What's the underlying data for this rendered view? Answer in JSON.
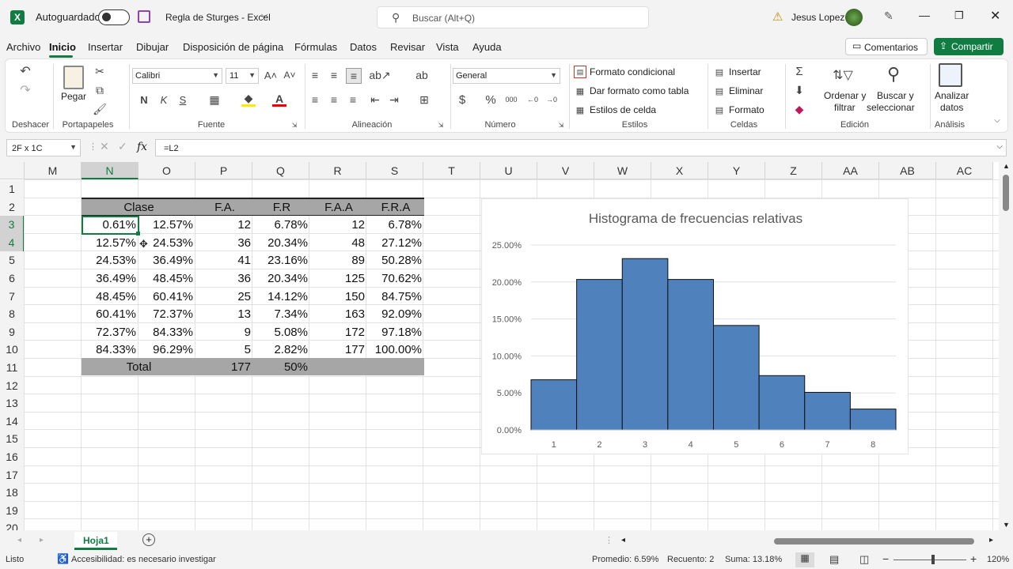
{
  "titlebar": {
    "autosave_label": "Autoguardado",
    "filename": "Regla de Sturges - Excel",
    "search_placeholder": "Buscar (Alt+Q)",
    "user_name": "Jesus Lopez"
  },
  "menu": {
    "tabs": [
      "Archivo",
      "Inicio",
      "Insertar",
      "Dibujar",
      "Disposición de página",
      "Fórmulas",
      "Datos",
      "Revisar",
      "Vista",
      "Ayuda"
    ],
    "comments_label": "Comentarios",
    "share_label": "Compartir"
  },
  "ribbon": {
    "groups": {
      "undo": "Deshacer",
      "clipboard": "Portapapeles",
      "font": "Fuente",
      "alignment": "Alineación",
      "number": "Número",
      "styles": "Estilos",
      "cells": "Celdas",
      "editing": "Edición",
      "analysis": "Análisis"
    },
    "paste_label": "Pegar",
    "font_name": "Calibri",
    "font_size": "11",
    "bold": "N",
    "italic": "K",
    "underline": "S",
    "number_format": "General",
    "conditional_format": "Formato condicional",
    "format_table": "Dar formato como tabla",
    "cell_styles": "Estilos de celda",
    "insert": "Insertar",
    "delete": "Eliminar",
    "format": "Formato",
    "sort_filter_1": "Ordenar y",
    "sort_filter_2": "filtrar",
    "find_select_1": "Buscar y",
    "find_select_2": "seleccionar",
    "analyze_1": "Analizar",
    "analyze_2": "datos"
  },
  "formula": {
    "name_box": "2F x 1C",
    "fx": "fx",
    "content": "=L2"
  },
  "columns": [
    "M",
    "N",
    "O",
    "P",
    "Q",
    "R",
    "S",
    "T",
    "U",
    "V",
    "W",
    "X",
    "Y",
    "Z",
    "AA",
    "AB",
    "AC"
  ],
  "rows": [
    "1",
    "2",
    "3",
    "4",
    "5",
    "6",
    "7",
    "8",
    "9",
    "10",
    "11",
    "12",
    "13",
    "14",
    "15",
    "16",
    "17",
    "18",
    "19",
    "20"
  ],
  "table": {
    "headers": [
      "Clase",
      "F.A.",
      "F.R",
      "F.A.A",
      "F.R.A"
    ],
    "rows": [
      [
        "0.61%",
        "12.57%",
        "12",
        "6.78%",
        "12",
        "6.78%"
      ],
      [
        "12.57%",
        "24.53%",
        "36",
        "20.34%",
        "48",
        "27.12%"
      ],
      [
        "24.53%",
        "36.49%",
        "41",
        "23.16%",
        "89",
        "50.28%"
      ],
      [
        "36.49%",
        "48.45%",
        "36",
        "20.34%",
        "125",
        "70.62%"
      ],
      [
        "48.45%",
        "60.41%",
        "25",
        "14.12%",
        "150",
        "84.75%"
      ],
      [
        "60.41%",
        "72.37%",
        "13",
        "7.34%",
        "163",
        "92.09%"
      ],
      [
        "72.37%",
        "84.33%",
        "9",
        "5.08%",
        "172",
        "97.18%"
      ],
      [
        "84.33%",
        "96.29%",
        "5",
        "2.82%",
        "177",
        "100.00%"
      ]
    ],
    "total_label": "Total",
    "total_fa": "177",
    "total_fr": "50%"
  },
  "chart_data": {
    "type": "bar",
    "title": "Histograma de frecuencias relativas",
    "categories": [
      "1",
      "2",
      "3",
      "4",
      "5",
      "6",
      "7",
      "8"
    ],
    "values": [
      6.78,
      20.34,
      23.16,
      20.34,
      14.12,
      7.34,
      5.08,
      2.82
    ],
    "yticks": [
      "0.00%",
      "5.00%",
      "10.00%",
      "15.00%",
      "20.00%",
      "25.00%"
    ],
    "ylim": [
      0,
      25
    ],
    "grid": true,
    "bar_color": "#4f81bd"
  },
  "sheet": {
    "tab": "Hoja1"
  },
  "status": {
    "ready": "Listo",
    "accessibility": "Accesibilidad: es necesario investigar",
    "average": "Promedio: 6.59%",
    "count": "Recuento: 2",
    "sum": "Suma: 13.18%",
    "zoom": "120%"
  },
  "colors": {
    "excel_green": "#107c41",
    "header_gray": "#a6a6a6"
  }
}
